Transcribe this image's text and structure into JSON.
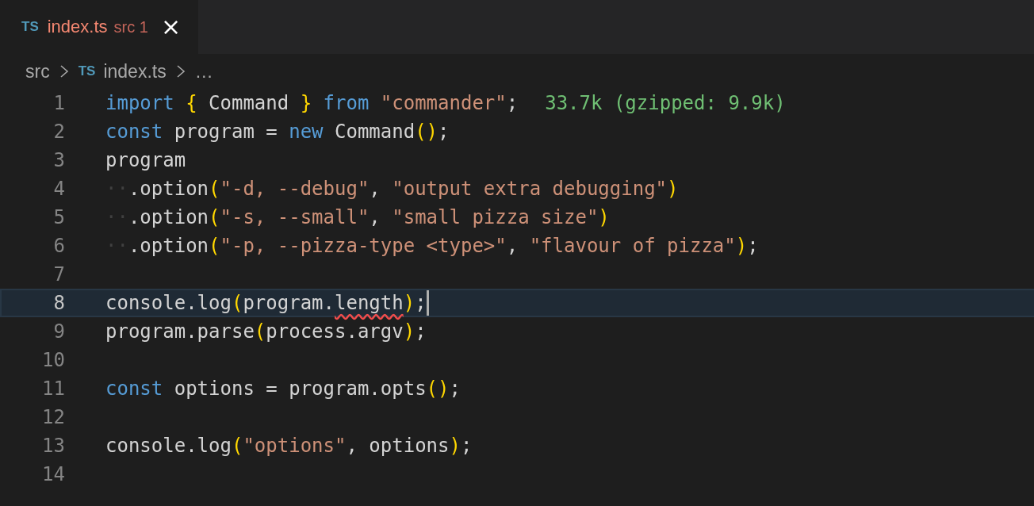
{
  "tabs": [
    {
      "icon": "TS",
      "label": "index.ts",
      "description": "src",
      "problems": "1",
      "close": "×",
      "selected": true,
      "has_error": true
    }
  ],
  "breadcrumb": [
    {
      "kind": "folder",
      "text": "src"
    },
    {
      "kind": "file",
      "icon": "TS",
      "text": "index.ts"
    },
    {
      "kind": "more",
      "text": "…"
    }
  ],
  "lines": [
    {
      "number": "1",
      "current": false,
      "tokens": [
        {
          "kind": "keyword",
          "text": "import "
        },
        {
          "kind": "bracket",
          "text": "{"
        },
        {
          "kind": "plain",
          "text": " Command "
        },
        {
          "kind": "bracket",
          "text": "}"
        },
        {
          "kind": "keyword",
          "text": " from "
        },
        {
          "kind": "string",
          "text": "\"commander\""
        },
        {
          "kind": "plain",
          "text": ";"
        }
      ],
      "hint": "33.7k (gzipped: 9.9k)"
    },
    {
      "number": "2",
      "current": false,
      "tokens": [
        {
          "kind": "keyword",
          "text": "const"
        },
        {
          "kind": "plain",
          "text": " program = "
        },
        {
          "kind": "keyword",
          "text": "new"
        },
        {
          "kind": "plain",
          "text": " Command"
        },
        {
          "kind": "bracket",
          "text": "()"
        },
        {
          "kind": "plain",
          "text": ";"
        }
      ]
    },
    {
      "number": "3",
      "current": false,
      "tokens": [
        {
          "kind": "plain",
          "text": "program"
        }
      ]
    },
    {
      "number": "4",
      "current": false,
      "tokens": [
        {
          "kind": "whitespace",
          "text": "··"
        },
        {
          "kind": "plain",
          "text": ".option"
        },
        {
          "kind": "bracket",
          "text": "("
        },
        {
          "kind": "string",
          "text": "\"-d, --debug\""
        },
        {
          "kind": "plain",
          "text": ", "
        },
        {
          "kind": "string",
          "text": "\"output extra debugging\""
        },
        {
          "kind": "bracket",
          "text": ")"
        }
      ]
    },
    {
      "number": "5",
      "current": false,
      "tokens": [
        {
          "kind": "whitespace",
          "text": "··"
        },
        {
          "kind": "plain",
          "text": ".option"
        },
        {
          "kind": "bracket",
          "text": "("
        },
        {
          "kind": "string",
          "text": "\"-s, --small\""
        },
        {
          "kind": "plain",
          "text": ", "
        },
        {
          "kind": "string",
          "text": "\"small pizza size\""
        },
        {
          "kind": "bracket",
          "text": ")"
        }
      ]
    },
    {
      "number": "6",
      "current": false,
      "tokens": [
        {
          "kind": "whitespace",
          "text": "··"
        },
        {
          "kind": "plain",
          "text": ".option"
        },
        {
          "kind": "bracket",
          "text": "("
        },
        {
          "kind": "string",
          "text": "\"-p, --pizza-type <type>\""
        },
        {
          "kind": "plain",
          "text": ", "
        },
        {
          "kind": "string",
          "text": "\"flavour of pizza\""
        },
        {
          "kind": "bracket",
          "text": ")"
        },
        {
          "kind": "plain",
          "text": ";"
        }
      ]
    },
    {
      "number": "7",
      "current": false
    },
    {
      "number": "8",
      "current": true,
      "cursor": true,
      "tokens": [
        {
          "kind": "plain",
          "text": "console.log"
        },
        {
          "kind": "bracket",
          "text": "("
        },
        {
          "kind": "plain",
          "text": "program."
        },
        {
          "kind": "plain",
          "text": "length",
          "error": true
        },
        {
          "kind": "bracket",
          "text": ")"
        },
        {
          "kind": "plain",
          "text": ";"
        }
      ]
    },
    {
      "number": "9",
      "current": false,
      "tokens": [
        {
          "kind": "plain",
          "text": "program.parse"
        },
        {
          "kind": "bracket",
          "text": "("
        },
        {
          "kind": "plain",
          "text": "process.argv"
        },
        {
          "kind": "bracket",
          "text": ")"
        },
        {
          "kind": "plain",
          "text": ";"
        }
      ]
    },
    {
      "number": "10",
      "current": false
    },
    {
      "number": "11",
      "current": false,
      "tokens": [
        {
          "kind": "keyword",
          "text": "const"
        },
        {
          "kind": "plain",
          "text": " options = program.opts"
        },
        {
          "kind": "bracket",
          "text": "()"
        },
        {
          "kind": "plain",
          "text": ";"
        }
      ]
    },
    {
      "number": "12",
      "current": false
    },
    {
      "number": "13",
      "current": false,
      "tokens": [
        {
          "kind": "plain",
          "text": "console.log"
        },
        {
          "kind": "bracket",
          "text": "("
        },
        {
          "kind": "string",
          "text": "\"options\""
        },
        {
          "kind": "plain",
          "text": ", options"
        },
        {
          "kind": "bracket",
          "text": ")"
        },
        {
          "kind": "plain",
          "text": ";"
        }
      ]
    },
    {
      "number": "14",
      "current": false
    }
  ]
}
